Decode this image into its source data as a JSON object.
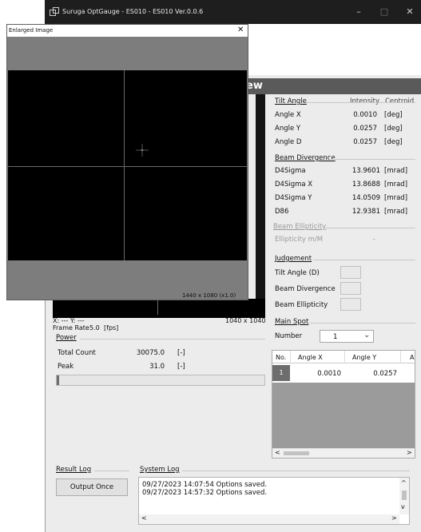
{
  "window": {
    "title": "Suruga OptGauge - ES010 - ES010 Ver.0.0.6",
    "min": "–",
    "max": "□",
    "close": "✕"
  },
  "view_header": "ew",
  "popup": {
    "title": "Enlarged Image",
    "close": "✕",
    "resolution": "1440 x 1080 (x1.0)"
  },
  "image": {
    "coords": "X: --- Y: ---",
    "resolution": "1040 x 1040",
    "frame_rate_label": "Frame Rate",
    "frame_rate_value": "5.0",
    "frame_rate_unit": "[fps]"
  },
  "tilt": {
    "header": "Tilt Angle",
    "mode_intensity": "Intensity",
    "mode_centroid": "Centroid",
    "rows": [
      {
        "label": "Angle X",
        "value": "0.0010",
        "unit": "[deg]"
      },
      {
        "label": "Angle Y",
        "value": "0.0257",
        "unit": "[deg]"
      },
      {
        "label": "Angle D",
        "value": "0.0257",
        "unit": "[deg]"
      }
    ]
  },
  "divergence": {
    "header": "Beam Divergence",
    "rows": [
      {
        "label": "D4Sigma",
        "value": "13.9601",
        "unit": "[mrad]"
      },
      {
        "label": "D4Sigma X",
        "value": "13.8688",
        "unit": "[mrad]"
      },
      {
        "label": "D4Sigma Y",
        "value": "14.0509",
        "unit": "[mrad]"
      },
      {
        "label": "D86",
        "value": "12.9381",
        "unit": "[mrad]"
      }
    ]
  },
  "ellipticity": {
    "header": "Beam Ellipticity",
    "label": "Ellipticity m/M",
    "value": "-"
  },
  "judgement": {
    "header": "Judgement",
    "items": [
      "Tilt Angle (D)",
      "Beam Divergence",
      "Beam Ellipticity"
    ]
  },
  "main_spot": {
    "header": "Main Spot",
    "number_label": "Number",
    "number_value": "1",
    "chevron": "⌄"
  },
  "table": {
    "columns": [
      "No.",
      "Angle X",
      "Angle Y",
      "A"
    ],
    "rows": [
      {
        "no": "1",
        "angle_x": "0.0010",
        "angle_y": "0.0257"
      }
    ],
    "left_arrow": "<",
    "right_arrow": ">"
  },
  "power": {
    "header": "Power",
    "rows": [
      {
        "label": "Total Count",
        "value": "30075.0",
        "unit": "[-]"
      },
      {
        "label": "Peak",
        "value": "31.0",
        "unit": "[-]"
      }
    ],
    "level": 0.01
  },
  "result_log": {
    "header": "Result Log",
    "button": "Output Once"
  },
  "system_log": {
    "header": "System Log",
    "lines": [
      "09/27/2023 14:07:54 Options saved.",
      "09/27/2023 14:57:32 Options saved."
    ],
    "up": "^",
    "down": "v",
    "left": "<",
    "right": ">"
  }
}
